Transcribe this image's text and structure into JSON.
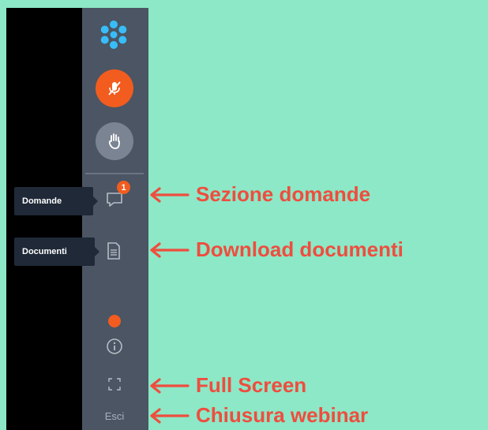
{
  "colors": {
    "background": "#8ce8c6",
    "sidebar": "#4b5563",
    "accent": "#f25c1f",
    "annotation": "#ef4d3f"
  },
  "sidebar": {
    "logo_icon": "snowflake-logo",
    "mic_icon": "mic-muted-icon",
    "hand_icon": "raise-hand-icon",
    "questions": {
      "tooltip": "Domande",
      "badge": "1",
      "icon": "chat-bubble-icon"
    },
    "documents": {
      "tooltip": "Documenti",
      "icon": "document-icon"
    },
    "info_icon": "info-icon",
    "fullscreen_icon": "expand-icon",
    "exit_label": "Esci"
  },
  "annotations": {
    "questions": "Sezione domande",
    "documents": "Download documenti",
    "fullscreen": "Full Screen",
    "exit": "Chiusura webinar"
  }
}
